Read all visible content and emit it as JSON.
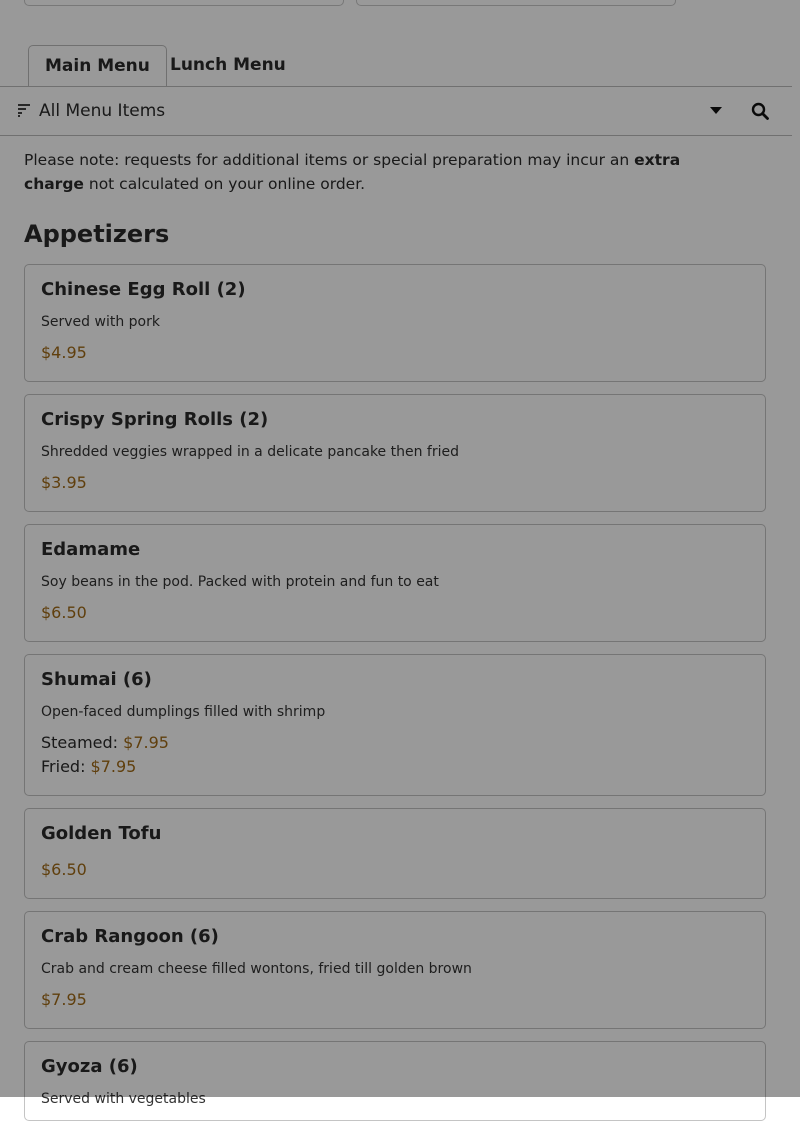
{
  "tabs": {
    "main_menu": "Main Menu",
    "lunch_menu": "Lunch Menu"
  },
  "filter": {
    "label": "All Menu Items",
    "filter_icon": "sort-filter-icon",
    "dropdown_icon": "caret-down-icon",
    "search_icon": "search-icon"
  },
  "note": {
    "before": "Please note: requests for additional items or special preparation may incur an ",
    "bold": "extra charge",
    "after": " not calculated on your online order."
  },
  "section": {
    "title": "Appetizers"
  },
  "items": [
    {
      "name": "Chinese Egg Roll (2)",
      "description": "Served with pork",
      "price": "$4.95"
    },
    {
      "name": "Crispy Spring Rolls (2)",
      "description": "Shredded veggies wrapped in a delicate pancake then fried",
      "price": "$3.95"
    },
    {
      "name": "Edamame",
      "description": "Soy beans in the pod. Packed with protein and fun to eat",
      "price": "$6.50"
    },
    {
      "name": "Shumai (6)",
      "description": "Open-faced dumplings filled with shrimp",
      "options": [
        {
          "label": "Steamed:",
          "price": "$7.95"
        },
        {
          "label": "Fried:",
          "price": "$7.95"
        }
      ]
    },
    {
      "name": "Golden Tofu",
      "price": "$6.50"
    },
    {
      "name": "Crab Rangoon (6)",
      "description": "Crab and cream cheese filled wontons, fried till golden brown",
      "price": "$7.95"
    },
    {
      "name": "Gyoza (6)",
      "description": "Served with vegetables"
    }
  ],
  "colors": {
    "price": "#a06a17",
    "overlay": "rgba(0,0,0,0.40)"
  }
}
